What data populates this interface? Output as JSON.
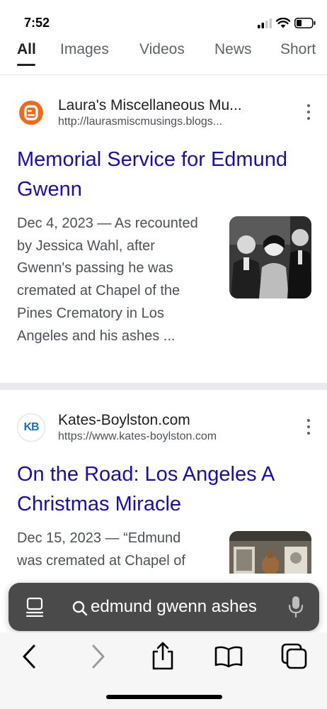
{
  "status_bar": {
    "time": "7:52"
  },
  "tabs": [
    {
      "label": "All",
      "active": true
    },
    {
      "label": "Images",
      "active": false
    },
    {
      "label": "Videos",
      "active": false
    },
    {
      "label": "News",
      "active": false
    },
    {
      "label": "Short",
      "active": false
    }
  ],
  "results": [
    {
      "site_name": "Laura's Miscellaneous Mu...",
      "url": "http://laurasmiscmusings.blogs...",
      "favicon_icon": "blogger-icon",
      "favicon_color": "#f06a1d",
      "title": "Memorial Service for Edmund Gwenn",
      "snippet": "Dec 4, 2023 — As recounted by Jessica Wahl, after Gwenn's passing he was cremated at Chapel of the Pines Crematory in Los Angeles and his ashes ..."
    },
    {
      "site_name": "Kates-Boylston.com",
      "url": "https://www.kates-boylston.com",
      "favicon_text": "KB",
      "favicon_color": "#1a73b8",
      "title": "On the Road: Los Angeles A Christmas Miracle",
      "snippet": "Dec 15, 2023 — “Edmund was cremated at Chapel of"
    }
  ],
  "search_bar": {
    "query": "edmund gwenn ashes"
  },
  "toolbar": {
    "icons": [
      "back-icon",
      "forward-icon",
      "share-icon",
      "bookmarks-icon",
      "tabs-icon"
    ]
  }
}
